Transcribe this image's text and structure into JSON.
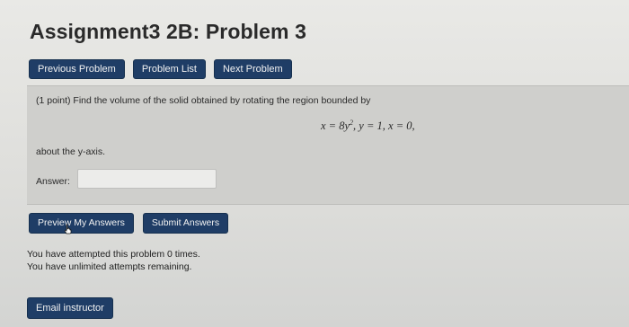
{
  "page": {
    "title": "Assignment3 2B: Problem 3"
  },
  "nav": {
    "previous": "Previous Problem",
    "list": "Problem List",
    "next": "Next Problem"
  },
  "problem": {
    "prompt": "(1 point) Find the volume of the solid obtained by rotating the region bounded by",
    "equation_x": "x = 8y",
    "equation_exp": "2",
    "equation_rest": ",  y = 1,  x = 0,",
    "about": "about the y-axis.",
    "answer_label": "Answer:",
    "answer_value": "",
    "answer_placeholder": ""
  },
  "actions": {
    "preview": "Preview My Answers",
    "submit": "Submit Answers"
  },
  "status": {
    "attempted": "You have attempted this problem 0 times.",
    "remaining": "You have unlimited attempts remaining."
  },
  "footer": {
    "email": "Email instructor"
  },
  "colors": {
    "button_bg": "#1f3d66",
    "button_text": "#f2f2f2"
  },
  "icons": {
    "cursor": "hand-cursor-icon"
  }
}
